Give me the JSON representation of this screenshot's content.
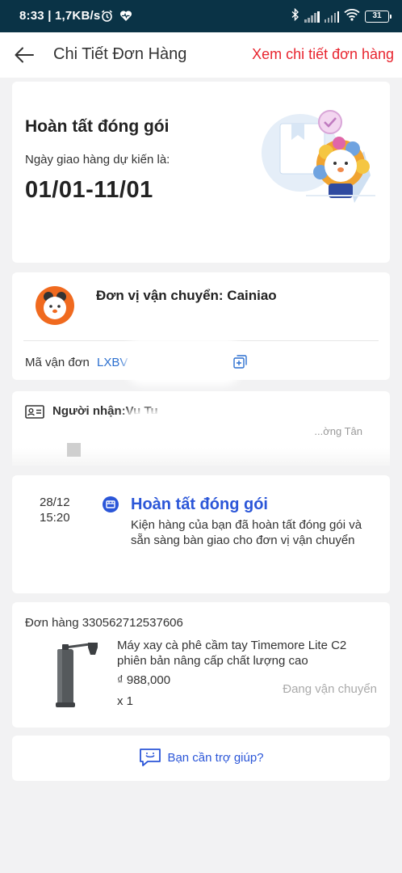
{
  "status_bar": {
    "time_speed": "8:33 | 1,7KB/s",
    "battery": "31"
  },
  "header": {
    "title": "Chi Tiết Đơn Hàng",
    "link": "Xem chi tiết đơn hàng"
  },
  "package_status": {
    "title": "Hoàn tất đóng gói",
    "subtitle": "Ngày giao hàng dự kiến là:",
    "date_range": "01/01-11/01"
  },
  "shipping": {
    "carrier": "Đơn vị vận chuyển: Cainiao",
    "tracking_label": "Mã vận đơn",
    "tracking_value": "LXBV"
  },
  "recipient": {
    "label": "Người nhận:Vu Tu",
    "address_fragment": "...ờng Tân"
  },
  "timeline": {
    "date": "28/12",
    "time": "15:20",
    "title": "Hoàn tất đóng gói",
    "description": "Kiện hàng của bạn đã hoàn tất đóng gói và sẵn sàng bàn giao cho đơn vị vận chuyển"
  },
  "order": {
    "order_number": "Đơn hàng 330562712537606",
    "product_name": "Máy xay cà phê cầm tay Timemore Lite C2 phiên bản nâng cấp chất lượng cao",
    "price": "₫ 988,000",
    "quantity": "x 1",
    "status": "Đang vận chuyển"
  },
  "help": {
    "label": "Bạn cần trợ giúp?"
  },
  "colors": {
    "accent_red": "#e8252f",
    "accent_blue": "#2b56d8",
    "link_blue": "#2b6fcf",
    "status_bar": "#0a3346"
  }
}
